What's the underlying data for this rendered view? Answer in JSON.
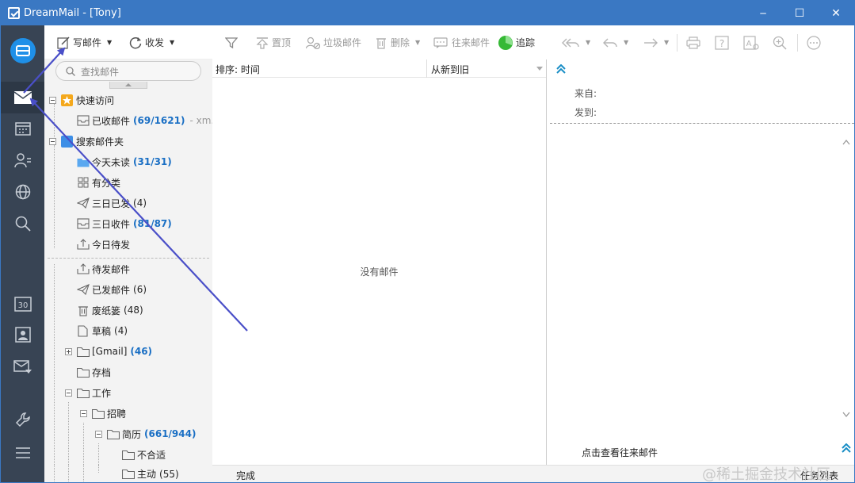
{
  "window": {
    "title": "DreamMail - [Tony]",
    "minimize": "─",
    "maximize": "☐",
    "close": "✕"
  },
  "toolbar_left": {
    "compose": "写邮件",
    "receive": "收发"
  },
  "toolbar_mid": {
    "pin": "置顶",
    "junk": "垃圾邮件",
    "delete": "删除",
    "correspondence": "往来邮件",
    "track": "追踪"
  },
  "search": {
    "placeholder": "查找邮件"
  },
  "folders": {
    "quick_access": {
      "label": "快速访问"
    },
    "inbox": {
      "label": "已收邮件",
      "count": "(69/1621)",
      "extra": "- xm..."
    },
    "search_folders": {
      "label": "搜索邮件夹"
    },
    "today_unread": {
      "label": "今天未读",
      "count": "(31/31)"
    },
    "attachments": {
      "label": "有分类"
    },
    "sent_3days": {
      "label": "三日已发",
      "count": "(4)"
    },
    "received_3days": {
      "label": "三日收件",
      "count": "(81/87)"
    },
    "today_pending": {
      "label": "今日待发"
    },
    "outbox": {
      "label": "待发邮件"
    },
    "sent": {
      "label": "已发邮件",
      "count": "(6)"
    },
    "trash": {
      "label": "废纸篓",
      "count": "(48)"
    },
    "drafts": {
      "label": "草稿",
      "count": "(4)"
    },
    "gmail": {
      "label": "[Gmail]",
      "count": "(46)"
    },
    "archive": {
      "label": "存档"
    },
    "work": {
      "label": "工作"
    },
    "recruit": {
      "label": "招聘"
    },
    "resume": {
      "label": "简历",
      "count": "(661/944)"
    },
    "unsuitable": {
      "label": "不合适"
    },
    "active": {
      "label": "主动",
      "count": "(55)"
    }
  },
  "message_list": {
    "sort_label": "排序: 时间",
    "sort_order": "从新到旧",
    "empty": "没有邮件"
  },
  "reading_pane": {
    "from_label": "来自:",
    "to_label": "发到:",
    "view_correspondence": "点击查看往来邮件"
  },
  "status": {
    "text": "完成",
    "task_list": "任务列表"
  },
  "watermark": "@稀土掘金技术社区",
  "colors": {
    "titlebar": "#3a78c3",
    "nav": "#384454",
    "count": "#1a6fc4",
    "annotation_arrow": "#4a4fc8"
  }
}
